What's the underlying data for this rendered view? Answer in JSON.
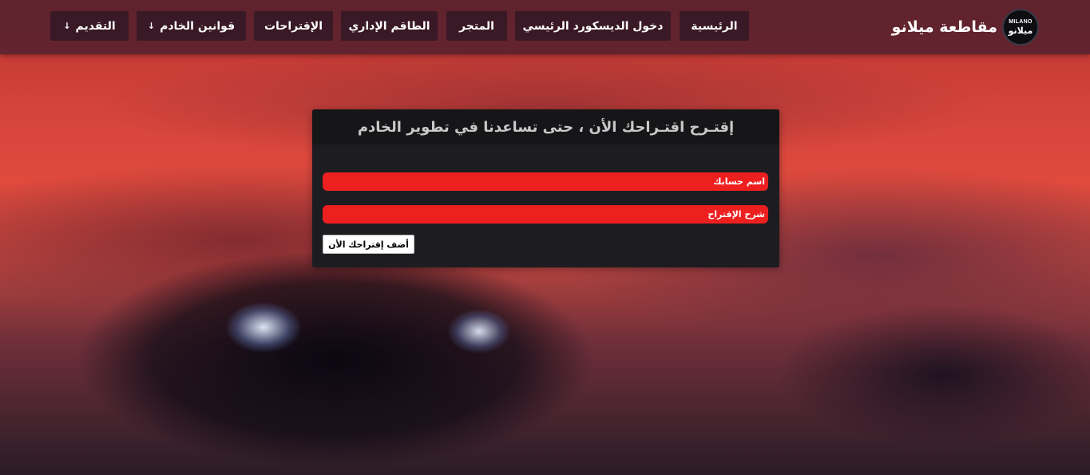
{
  "brand": {
    "logo_top": "MILANO",
    "logo_bottom": "ميلانو",
    "name": "مقاطعة ميلانو"
  },
  "nav": {
    "home": "الرئيسية",
    "discord": "دخول الديسكورد الرئيسي",
    "store": "المتجر",
    "staff": "الطاقم الإداري",
    "suggestions": "الإقتراحات",
    "rules": "قوانين الخادم",
    "apply": "التقديم",
    "caret": "↓"
  },
  "form": {
    "title": "إقتـرح اقتـراحك الأن ، حتى تساعدنا في تطوير الخادم",
    "account_placeholder": "اسم حسابك",
    "description_placeholder": "شرح الإقتراح",
    "submit_label": "أضف إقتراحك الأن"
  }
}
